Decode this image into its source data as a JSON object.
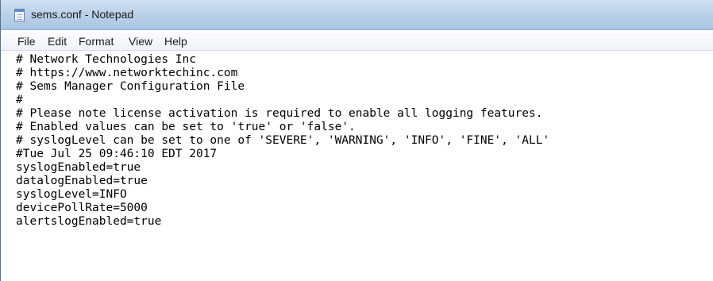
{
  "window": {
    "title": "sems.conf - Notepad"
  },
  "menu": {
    "file": "File",
    "edit": "Edit",
    "format": "Format",
    "view": "View",
    "help": "Help"
  },
  "editor": {
    "lines": [
      "# Network Technologies Inc",
      "# https://www.networktechinc.com",
      "# Sems Manager Configuration File",
      "#",
      "# Please note license activation is required to enable all logging features.",
      "# Enabled values can be set to 'true' or 'false'.",
      "# syslogLevel can be set to one of 'SEVERE', 'WARNING', 'INFO', 'FINE', 'ALL'",
      "#Tue Jul 25 09:46:10 EDT 2017",
      "syslogEnabled=true",
      "datalogEnabled=true",
      "syslogLevel=INFO",
      "devicePollRate=5000",
      "alertslogEnabled=true"
    ]
  }
}
